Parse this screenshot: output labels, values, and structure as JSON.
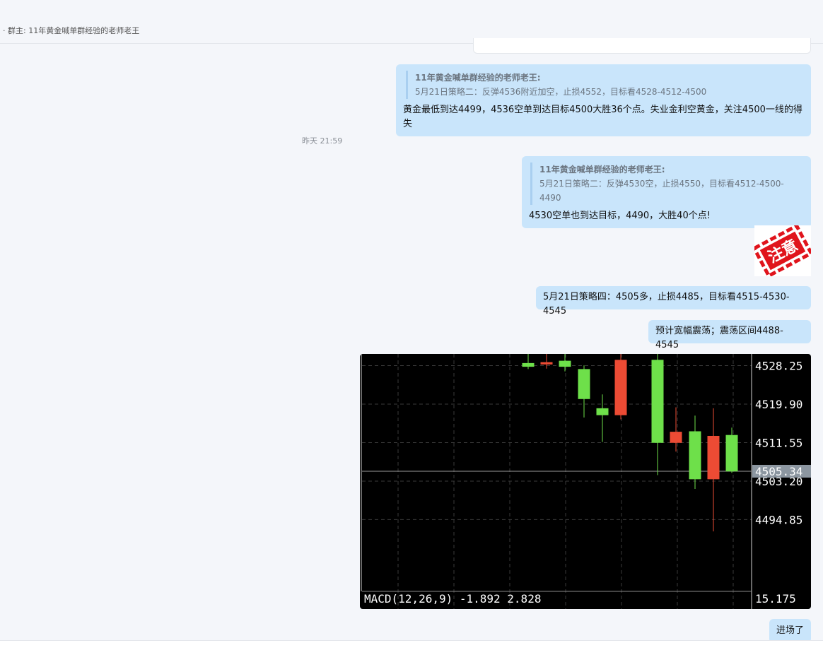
{
  "header": {
    "owner_line": "· 群主: 11年黄金喊单群经验的老师老王"
  },
  "messages": {
    "m1": {
      "quote_author": "11年黄金喊单群经验的老师老王:",
      "quote_text": "5月21日策略二：反弹4536附近加空，止损4552，目标看4528-4512-4500",
      "text": "黄金最低到达4499，4536空单到达目标4500大胜36个点。失业金利空黄金，关注4500一线的得失"
    },
    "timestamp": "昨天 21:59",
    "m2": {
      "quote_author": "11年黄金喊单群经验的老师老王:",
      "quote_text": "5月21日策略二：反弹4530空，止损4550，目标看4512-4500-4490",
      "text": "4530空单也到达目标，4490，大胜40个点!"
    },
    "sticker": {
      "text": "注意"
    },
    "m3": {
      "text": "5月21日策略四：4505多，止损4485，目标看4515-4530-4545"
    },
    "m4": {
      "text": "预计宽幅震荡；震荡区间4488-4545"
    },
    "m5": {
      "text": "进场了"
    }
  },
  "colors": {
    "bubble": "#c9e5fb",
    "up": "#6ee04a",
    "down": "#ec4b34",
    "chart_bg": "#000000"
  },
  "chart_data": {
    "type": "candlestick",
    "price_ticks": [
      "4528.25",
      "4519.90",
      "4511.55",
      "4503.20",
      "4494.85"
    ],
    "current_price": "4505.34",
    "macd_label": "MACD(12,26,9) -1.892 2.828",
    "macd_scale": "15.175",
    "ylim": [
      4489.4,
      4529.7
    ],
    "candles": [
      {
        "o": 4528.8,
        "c": 4528.0,
        "h": 4533.0,
        "l": 4527.5,
        "dir": "up"
      },
      {
        "o": 4528.5,
        "c": 4529.0,
        "h": 4532.0,
        "l": 4527.6,
        "dir": "down"
      },
      {
        "o": 4528.0,
        "c": 4529.3,
        "h": 4533.0,
        "l": 4527.0,
        "dir": "up"
      },
      {
        "o": 4527.5,
        "c": 4521.0,
        "h": 4528.3,
        "l": 4517.0,
        "dir": "up"
      },
      {
        "o": 4519.0,
        "c": 4517.5,
        "h": 4522.0,
        "l": 4511.7,
        "dir": "up"
      },
      {
        "o": 4517.5,
        "c": 4529.5,
        "h": 4533.0,
        "l": 4516.6,
        "dir": "down"
      },
      {
        "o": 4529.5,
        "c": 4511.5,
        "h": 4533.0,
        "l": 4504.5,
        "dir": "up"
      },
      {
        "o": 4511.5,
        "c": 4513.9,
        "h": 4519.2,
        "l": 4509.6,
        "dir": "down"
      },
      {
        "o": 4514.0,
        "c": 4503.6,
        "h": 4517.4,
        "l": 4501.5,
        "dir": "up"
      },
      {
        "o": 4513.0,
        "c": 4503.6,
        "h": 4519.0,
        "l": 4492.3,
        "dir": "down"
      },
      {
        "o": 4513.2,
        "c": 4505.3,
        "h": 4514.8,
        "l": 4505.0,
        "dir": "up"
      }
    ]
  }
}
